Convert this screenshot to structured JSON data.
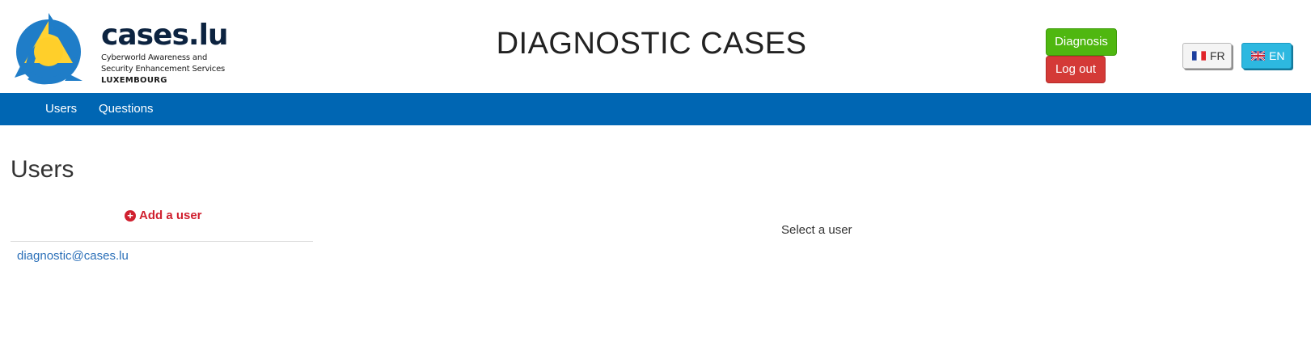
{
  "brand": {
    "name": "cases.lu",
    "subtitle_line1": "Cyberworld Awareness and",
    "subtitle_line2": "Security Enhancement Services",
    "country": "LUXEMBOURG"
  },
  "header": {
    "title": "DIAGNOSTIC CASES",
    "diagnosis_label": "Diagnosis",
    "logout_label": "Log out",
    "languages": [
      {
        "code": "FR",
        "label": "FR",
        "flag": "france-flag-icon",
        "active": false
      },
      {
        "code": "EN",
        "label": "EN",
        "flag": "uk-flag-icon",
        "active": true
      }
    ]
  },
  "nav": {
    "items": [
      {
        "label": "Users"
      },
      {
        "label": "Questions"
      }
    ]
  },
  "main": {
    "heading": "Users",
    "add_user_label": "Add a user",
    "add_user_icon": "plus-circle-icon",
    "users": [
      "diagnostic@cases.lu"
    ],
    "empty_selection_message": "Select a user"
  },
  "colors": {
    "nav_bar": "#0066b3",
    "diagnosis_button": "#4fb710",
    "logout_button": "#d43a37",
    "active_language": "#2db8e0",
    "accent_red": "#d0202f",
    "link": "#2a6fb8"
  }
}
